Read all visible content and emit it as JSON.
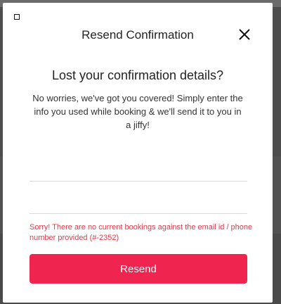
{
  "modal": {
    "title": "Resend Confirmation",
    "headline": "Lost your confirmation details?",
    "description": "No worries, we've got you covered! Simply enter the info you used while booking & we'll send it to you in a jiffy!",
    "email_field": {
      "value": "",
      "placeholder": ""
    },
    "phone_field": {
      "value": "",
      "placeholder": ""
    },
    "error_message": "Sorry! There are no current bookings against the email id / phone number provided (#-2352)",
    "resend_label": "Resend",
    "close_icon": "close-icon"
  },
  "colors": {
    "accent": "#f0254f",
    "error": "#e03a4a"
  }
}
